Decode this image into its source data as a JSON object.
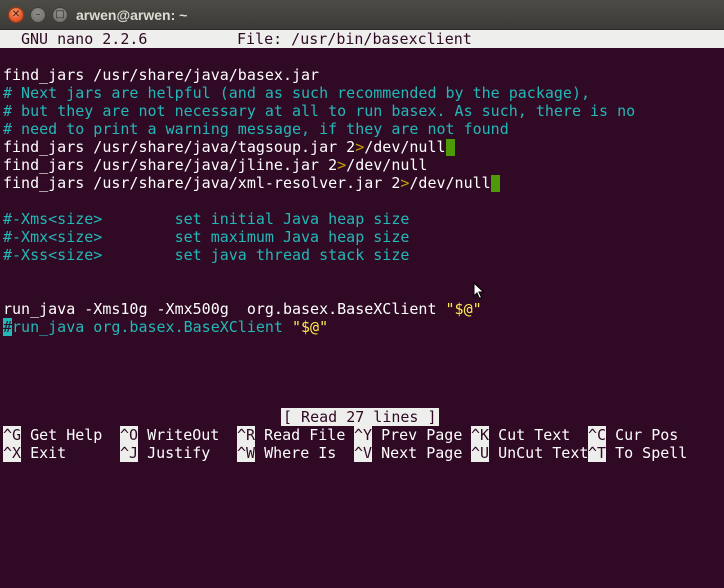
{
  "window": {
    "title": "arwen@arwen: ~",
    "controls": {
      "close": "✕",
      "minimize": "–",
      "maximize": "□"
    }
  },
  "nano": {
    "version": "GNU nano 2.2.6",
    "file": "File: /usr/bin/basexclient"
  },
  "lines": {
    "l1": "find_jars /usr/share/java/basex.jar",
    "l2": "# Next jars are helpful (and as such recommended by the package),",
    "l3": "# but they are not necessary at all to run basex. As such, there is no",
    "l4": "# need to print a warning message, if they are not found",
    "l5_a": "find_jars /usr/share/java/tagsoup.jar 2",
    "l5_b": ">",
    "l5_c": "/dev/null",
    "l6_a": "find_jars /usr/share/java/jline.jar 2",
    "l6_b": ">",
    "l6_c": "/dev/null",
    "l7_a": "find_jars /usr/share/java/xml-resolver.jar 2",
    "l7_b": ">",
    "l7_c": "/dev/null",
    "l8": "#-Xms<size>        set initial Java heap size",
    "l9": "#-Xmx<size>        set maximum Java heap size",
    "l10": "#-Xss<size>        set java thread stack size",
    "l11_a": "run_java -Xms10g -Xmx500g  org.basex.BaseXClient ",
    "l11_b": "\"$@\"",
    "l12_cursor": "#",
    "l12_a": "run_java org.basex.BaseXClient ",
    "l12_b": "\"$@\""
  },
  "status": "[ Read 27 lines ]",
  "shortcuts": {
    "row1": [
      {
        "key": "^G",
        "label": "Get Help"
      },
      {
        "key": "^O",
        "label": "WriteOut"
      },
      {
        "key": "^R",
        "label": "Read File"
      },
      {
        "key": "^Y",
        "label": "Prev Page"
      },
      {
        "key": "^K",
        "label": "Cut Text"
      },
      {
        "key": "^C",
        "label": "Cur Pos"
      }
    ],
    "row2": [
      {
        "key": "^X",
        "label": "Exit"
      },
      {
        "key": "^J",
        "label": "Justify"
      },
      {
        "key": "^W",
        "label": "Where Is"
      },
      {
        "key": "^V",
        "label": "Next Page"
      },
      {
        "key": "^U",
        "label": "UnCut Text"
      },
      {
        "key": "^T",
        "label": "To Spell"
      }
    ]
  },
  "colors": {
    "background": "#300a24",
    "comment": "#22b8b8",
    "redirect": "#c4a000",
    "string": "#fce94f",
    "trailing_whitespace": "#4e9a06"
  },
  "icons": {
    "pointer": "mouse-pointer-icon"
  }
}
